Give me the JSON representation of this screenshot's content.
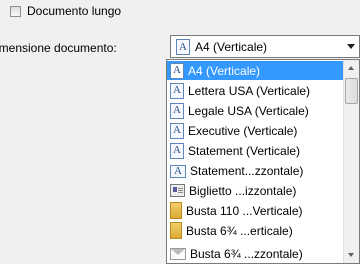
{
  "long_document": {
    "label": "Documento lungo",
    "checked": false
  },
  "document_size": {
    "label": "imensione documento:",
    "selected": "A4 (Verticale)"
  },
  "list": {
    "items": [
      {
        "label": "A4 (Verticale)",
        "icon": "page-portrait-icon",
        "selected": true
      },
      {
        "label": "Lettera USA (Verticale)",
        "icon": "page-portrait-icon"
      },
      {
        "label": "Legale USA (Verticale)",
        "icon": "page-portrait-icon"
      },
      {
        "label": "Executive (Verticale)",
        "icon": "page-portrait-icon"
      },
      {
        "label": "Statement (Verticale)",
        "icon": "page-portrait-icon"
      },
      {
        "label": "Statement...zzontale)",
        "icon": "page-landscape-icon"
      },
      {
        "label": "Biglietto ...izzontale)",
        "icon": "business-card-icon"
      },
      {
        "label": "Busta 110 ...Verticale)",
        "icon": "envelope-portrait-icon"
      },
      {
        "label": "Busta 6¾ ...erticale)",
        "icon": "envelope-portrait-icon"
      },
      {
        "label": "Busta 6¾ ...zzontale)",
        "icon": "envelope-landscape-icon"
      }
    ]
  },
  "colors": {
    "selection": "#3399ff",
    "background": "#f0f0f0"
  }
}
